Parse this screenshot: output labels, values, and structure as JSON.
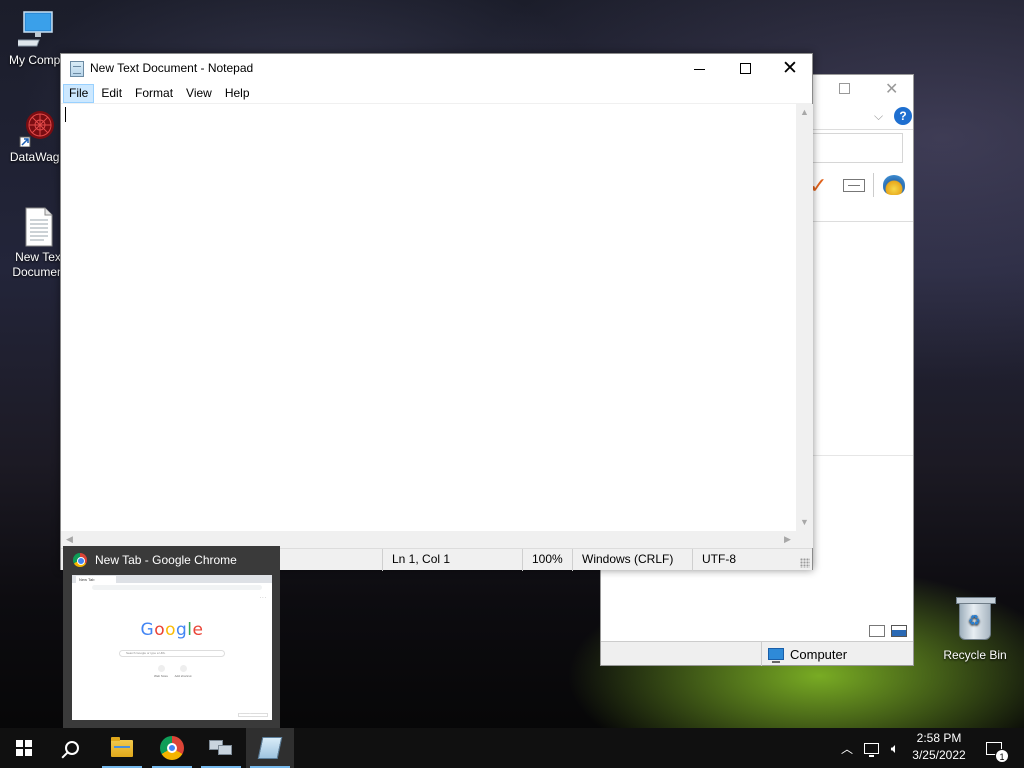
{
  "desktop": {
    "icons": [
      {
        "label": "My Compu",
        "icon": "monitor-icon"
      },
      {
        "label": "DataWago",
        "icon": "datawagon-app-icon"
      },
      {
        "label": "New Tex Documen",
        "icon": "text-document-icon"
      }
    ],
    "recycle_bin": {
      "label": "Recycle Bin",
      "icon": "recycle-bin-icon"
    }
  },
  "explorer": {
    "status_text": "Computer"
  },
  "notepad": {
    "title": "New Text Document - Notepad",
    "menu": [
      "File",
      "Edit",
      "Format",
      "View",
      "Help"
    ],
    "active_menu": "File",
    "content": "",
    "status": {
      "position": "Ln 1, Col 1",
      "zoom": "100%",
      "line_ending": "Windows (CRLF)",
      "encoding": "UTF-8"
    }
  },
  "taskbar_preview": {
    "title": "New Tab - Google Chrome",
    "thumbnail": {
      "tab_label": "New Tab",
      "logo": "Google",
      "search_placeholder": "Search Google or type a URL",
      "shortcuts": [
        "Web Store",
        "Add shortcut"
      ],
      "customize": "Customize Chrome"
    }
  },
  "taskbar": {
    "apps": [
      {
        "name": "File Explorer",
        "icon": "folder-icon",
        "running": true
      },
      {
        "name": "Google Chrome",
        "icon": "chrome-icon",
        "running": true
      },
      {
        "name": "Network Computers",
        "icon": "computers-icon",
        "running": true
      },
      {
        "name": "Notepad",
        "icon": "notepad-icon",
        "running": true,
        "active": true
      }
    ],
    "clock": {
      "time": "2:58 PM",
      "date": "3/25/2022"
    },
    "notifications_count": "1"
  },
  "colors": {
    "accent_blue": "#76b9ed",
    "menu_highlight": "#cce8ff",
    "taskbar": "#101010"
  }
}
